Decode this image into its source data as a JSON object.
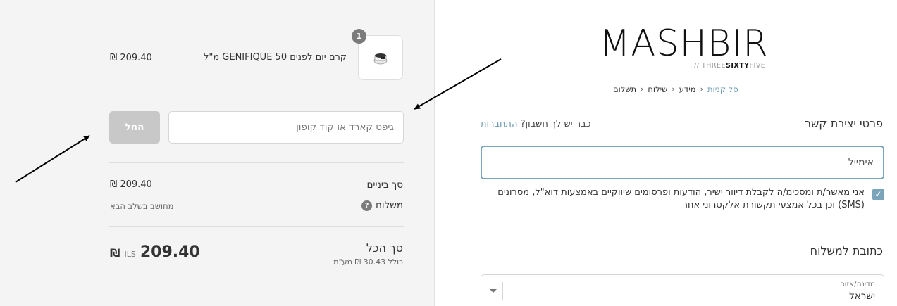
{
  "summary": {
    "product": {
      "quantity": "1",
      "name": "קרם יום לפנים GENIFIQUE 50 מ\"ל",
      "price": "₪ 209.40"
    },
    "coupon": {
      "placeholder": "גיפט קארד או קוד קופון",
      "apply_label": "החל"
    },
    "subtotal": {
      "label": "סך ביניים",
      "value": "₪ 209.40"
    },
    "shipping": {
      "label": "משלוח",
      "note": "מחושב בשלב הבא",
      "help_icon": "?"
    },
    "total": {
      "label": "סך הכל",
      "tax_note": "כולל 30.43 ₪ מע\"מ",
      "currency_code": "ILS",
      "currency_symbol": "₪",
      "amount": "209.40"
    }
  },
  "header": {
    "logo": "MASHBIR",
    "logo_sub_prefix": "// THREE",
    "logo_sub_bold": "SIXTY",
    "logo_sub_suffix": "FIVE"
  },
  "breadcrumb": {
    "items": [
      "סל קניות",
      "מידע",
      "שילוח",
      "תשלום"
    ]
  },
  "contact": {
    "title": "פרטי יצירת קשר",
    "login_prompt": "כבר יש לך חשבון?",
    "login_link": "התחברות",
    "email_placeholder": "אימייל",
    "consent_text": "אני מאשר/ת ומסכימ/ה לקבלת דיוור ישיר, הודעות ופרסומים שיווקיים באמצעות דוא\"ל, מסרונים (SMS) וכן בכל אמצעי תקשורת אלקטרוני אחר",
    "consent_checked": true
  },
  "shipping_address": {
    "title": "כתובת למשלוח",
    "country_label": "מדינה/אזור",
    "country_value": "ישראל"
  },
  "colors": {
    "accent": "#7aa4b9",
    "link": "#6b9bb0",
    "button_disabled": "#c8c8c8",
    "summary_bg": "#f4f4f4"
  }
}
